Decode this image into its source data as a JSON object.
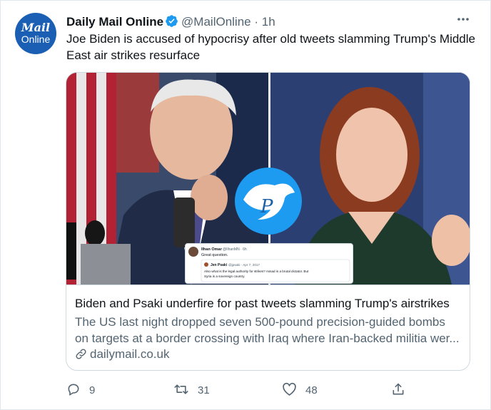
{
  "tweet": {
    "avatar": {
      "line1": "Mail",
      "line2": "Online",
      "bg_color": "#1a5fb4"
    },
    "author_name": "Daily Mail Online",
    "handle": "@MailOnline",
    "separator": "·",
    "time": "1h",
    "more_icon": "more-horizontal-icon",
    "text": "Joe Biden is accused of hypocrisy after old tweets slamming Trump's Middle East air strikes resurface"
  },
  "card": {
    "title": "Biden and Psaki underfire for past tweets slamming Trump's airstrikes",
    "description_line1": "The US last night dropped seven 500-pound precision-guided bombs",
    "description_line2": "on targets at a border crossing with Iraq where Iran-backed militia wer...",
    "domain": "dailymail.co.uk",
    "image": {
      "embedded_tweet": {
        "name": "Ilhan Omar",
        "handle": "@IlhanMN · 6h",
        "text": "Great question.",
        "quoted_name": "Jen Psaki",
        "quoted_handle": "@jpsaki · Apr 7, 2017",
        "quoted_text_line1": "Also what is the legal authority for strikes? Assad is a brutal dictator. But",
        "quoted_text_line2": "Syria is a sovereign country."
      }
    }
  },
  "actions": {
    "reply_count": "9",
    "retweet_count": "31",
    "like_count": "48"
  },
  "colors": {
    "accent": "#1d9bf0",
    "text_primary": "#0f1419",
    "text_secondary": "#536471",
    "border": "#cfd9de"
  }
}
